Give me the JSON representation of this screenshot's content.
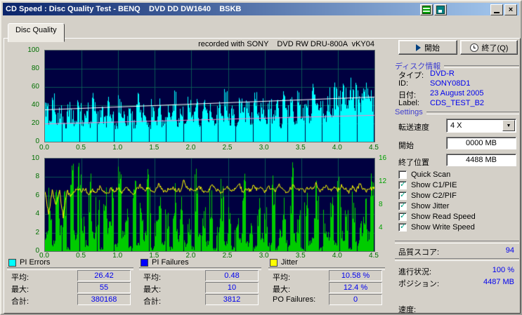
{
  "window": {
    "title": "CD Speed : Disc Quality Test - BENQ    DVD DD DW1640    BSKB"
  },
  "tab": {
    "label": "Disc Quality"
  },
  "chart_header": "recorded with SONY    DVD RW DRU-800A  vKY04",
  "buttons": {
    "start": "開始",
    "quit": "終了(Q)"
  },
  "disc_info": {
    "header": "ディスク情報",
    "rows": [
      {
        "label": "タイプ:",
        "value": "DVD-R"
      },
      {
        "label": "ID:",
        "value": "SONY08D1"
      },
      {
        "label": "日付:",
        "value": "23 August 2005"
      },
      {
        "label": "Label:",
        "value": "CDS_TEST_B2"
      }
    ]
  },
  "settings": {
    "header": "Settings",
    "speed_label": "転送速度",
    "speed_value": "4 X",
    "start_label": "開始",
    "start_value": "0000 MB",
    "end_label": "終了位置",
    "end_value": "4488 MB",
    "checkboxes": [
      {
        "label": "Quick Scan",
        "checked": false
      },
      {
        "label": "Show C1/PIE",
        "checked": true
      },
      {
        "label": "Show C2/PIF",
        "checked": true
      },
      {
        "label": "Show Jitter",
        "checked": true
      },
      {
        "label": "Show Read Speed",
        "checked": true
      },
      {
        "label": "Show Write Speed",
        "checked": true
      }
    ]
  },
  "status": {
    "score_label": "品質スコア:",
    "score_value": "94",
    "progress_label": "進行状況:",
    "progress_value": "100 %",
    "position_label": "ポジション:",
    "position_value": "4487 MB",
    "speed_label": "速度:",
    "speed_value": ""
  },
  "stats": {
    "panels": [
      {
        "id": "pi-errors",
        "title": "PI Errors",
        "color": "#00ffff",
        "rows": [
          [
            "平均:",
            "26.42"
          ],
          [
            "最大:",
            "55"
          ],
          [
            "合計:",
            "380168"
          ]
        ]
      },
      {
        "id": "pi-failures",
        "title": "PI Failures",
        "color": "#0000ff",
        "rows": [
          [
            "平均:",
            "0.48"
          ],
          [
            "最大:",
            "10"
          ],
          [
            "合計:",
            "3812"
          ]
        ]
      },
      {
        "id": "jitter",
        "title": "Jitter",
        "color": "#ffff00",
        "rows": [
          [
            "平均:",
            "10.58 %"
          ],
          [
            "最大:",
            "12.4 %"
          ],
          [
            "PO Failures:",
            "0"
          ]
        ]
      }
    ]
  },
  "chart_data": [
    {
      "type": "area",
      "bg": "#000040",
      "grid_color": "#0a5555",
      "xlim": [
        0,
        4.5
      ],
      "ylim": [
        0,
        100
      ],
      "x_ticks": [
        "0.0",
        "0.5",
        "1.0",
        "1.5",
        "2.0",
        "2.5",
        "3.0",
        "3.5",
        "4.0",
        "4.5"
      ],
      "y_ticks": [
        "100",
        "80",
        "60",
        "40",
        "20",
        "0"
      ],
      "series": [
        {
          "name": "PI Errors",
          "render": "bars",
          "color": "#00ffff",
          "values": [
            36,
            18,
            42,
            25,
            33,
            20,
            38,
            28,
            22,
            40,
            24,
            35,
            19,
            43,
            27,
            31,
            22,
            39,
            26,
            17,
            41,
            29,
            23,
            36,
            20,
            44,
            27,
            33,
            18,
            38,
            25,
            42,
            21,
            35,
            28,
            45,
            23,
            31,
            19,
            40,
            26,
            37,
            22,
            44,
            29,
            34,
            20,
            41,
            27,
            46,
            24,
            38,
            21,
            43,
            30,
            35,
            25,
            47,
            28,
            39,
            23,
            45,
            27,
            36,
            21,
            48,
            31,
            40,
            26,
            44,
            29,
            38,
            24,
            49,
            33,
            42,
            28,
            46,
            35,
            50,
            44,
            52,
            47,
            55,
            48,
            51,
            46,
            53,
            49,
            45
          ]
        },
        {
          "name": "Read Speed",
          "render": "line",
          "color": "#ffffff",
          "x": [
            0,
            4.5
          ],
          "y": [
            35,
            49
          ]
        },
        {
          "name": "Write Speed",
          "render": "line",
          "color": "#ff82c8",
          "x": [
            0,
            4.5
          ],
          "y": [
            19.5,
            29
          ]
        }
      ]
    },
    {
      "type": "bar+line",
      "bg": "#000040",
      "grid_color": "#0a5555",
      "xlim": [
        0,
        4.5
      ],
      "ylim_left": [
        0,
        10
      ],
      "ylim_right": [
        0,
        16
      ],
      "x_ticks": [
        "0.0",
        "0.5",
        "1.0",
        "1.5",
        "2.0",
        "2.5",
        "3.0",
        "3.5",
        "4.0",
        "4.5"
      ],
      "y_ticks_left": [
        "10",
        "8",
        "6",
        "4",
        "2",
        "0"
      ],
      "y_ticks_right": [
        "16",
        "12",
        "8",
        "4"
      ],
      "series": [
        {
          "name": "PI Failures",
          "render": "bars",
          "axis": "left",
          "color": "#00cc00",
          "values": [
            2,
            7,
            1,
            9,
            3,
            6,
            0,
            8,
            2,
            10,
            4,
            1,
            7,
            2,
            5,
            0,
            8,
            3,
            6,
            1,
            9,
            2,
            4,
            0,
            7,
            1,
            5,
            2,
            8,
            0,
            3,
            6,
            1,
            4,
            0,
            7,
            2,
            5,
            1,
            3,
            0,
            8,
            2,
            4,
            1,
            6,
            0,
            3,
            7,
            1,
            4,
            0,
            5,
            2,
            8,
            1,
            3,
            0,
            6,
            2,
            4,
            1,
            7,
            0,
            3,
            5,
            1,
            8,
            2,
            4,
            0,
            6,
            1,
            3,
            7,
            0,
            4,
            2,
            5,
            1,
            8,
            2,
            4,
            0,
            6,
            1,
            3,
            5,
            2,
            7
          ]
        },
        {
          "name": "Jitter",
          "render": "line",
          "axis": "right",
          "color": "#ffff00",
          "values": [
            10.2,
            6.3,
            10.5,
            7.8,
            10.4,
            5.8,
            10.6,
            9.2,
            10.5,
            10.8,
            10.4,
            10.7,
            9.8,
            10.6,
            10.3,
            11.0,
            10.5,
            9.9,
            10.7,
            10.4,
            10.8,
            10.2,
            11.1,
            10.5,
            9.7,
            10.6,
            11.3,
            10.4,
            10.9,
            10.6,
            10.3,
            11.5,
            10.7,
            10.2,
            10.8,
            11.0,
            10.4,
            10.6,
            12.4,
            10.5,
            10.9,
            10.3,
            11.2,
            10.6,
            10.1,
            10.8,
            11.4,
            10.5,
            10.2,
            10.7,
            11.0,
            10.4,
            10.9,
            11.6,
            10.3,
            10.8,
            10.5,
            11.2,
            10.6,
            10.9,
            10.4,
            11.1,
            10.7,
            10.3,
            11.5,
            10.6,
            10.2,
            10.9,
            11.3,
            10.5,
            10.8,
            10.4,
            11.0,
            10.6,
            11.8,
            10.3,
            10.7,
            11.2,
            10.5,
            10.9,
            10.6,
            11.4,
            10.8,
            10.3,
            11.0,
            10.5,
            11.6,
            10.7,
            10.4,
            10.8
          ]
        }
      ]
    }
  ]
}
